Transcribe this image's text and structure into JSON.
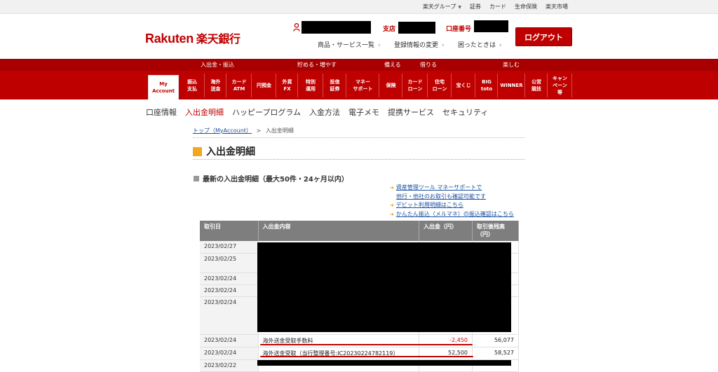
{
  "util_links": [
    "楽天グループ",
    "証券",
    "カード",
    "生命保険",
    "楽天市場"
  ],
  "header": {
    "logo_en": "Rakuten",
    "logo_jp": "楽天銀行",
    "branch_label": "支店",
    "account_label": "口座番号",
    "links": [
      "商品・サービス一覧",
      "登録情報の変更",
      "困ったときは"
    ],
    "logout": "ログアウト"
  },
  "categories": [
    "入出金・振込",
    "貯める・増やす",
    "備える",
    "借りる",
    "楽しむ"
  ],
  "nav": [
    "My\nAccount",
    "振込\n支払",
    "海外\n送金",
    "カード\nATM",
    "円預金",
    "外貨\nFX",
    "特別\n運用",
    "投信\n証券",
    "マネー\nサポート",
    "保険",
    "カード\nローン",
    "住宅\nローン",
    "宝くじ",
    "BIG\ntoto",
    "WINNER",
    "公営\n競技",
    "キャン\nペーン\n等"
  ],
  "subnav": [
    "口座情報",
    "入出金明細",
    "ハッピープログラム",
    "入金方法",
    "電子メモ",
    "提携サービス",
    "セキュリティ"
  ],
  "breadcrumb": {
    "home": "トップ（MyAccount）",
    "sep": ">",
    "current": "入出金明細"
  },
  "page_title": "入出金明細",
  "section_title": "最新の入出金明細（最大50件・24ヶ月以内）",
  "side_links": {
    "l1a": "資産管理ツール マネーサポートで",
    "l1b": "他行・他社のお取引も確認可能です",
    "l2": "デビット利用明細はこちら",
    "l3": "かんたん振込（メルマネ）の振込確認はこちら"
  },
  "table": {
    "headers": [
      "取引日",
      "入出金内容",
      "入出金（円）",
      "取引後残高（円）"
    ],
    "rows": [
      {
        "date": "2023/02/27",
        "desc": "",
        "amount": "",
        "balance": ""
      },
      {
        "date": "2023/02/25",
        "desc": "",
        "amount": "",
        "balance": ""
      },
      {
        "date": "2023/02/24",
        "desc": "",
        "amount": "",
        "balance": ""
      },
      {
        "date": "2023/02/24",
        "desc": "",
        "amount": "",
        "balance": ""
      },
      {
        "date": "2023/02/24",
        "desc": "",
        "amount": "",
        "balance": ""
      },
      {
        "date": "2023/02/24",
        "desc": "海外送金受取手数料",
        "amount": "-2,450",
        "balance": "56,077"
      },
      {
        "date": "2023/02/24",
        "desc": "海外送金受取（当行整理番号:IC20230224782119）",
        "amount": "52,500",
        "balance": "58,527"
      },
      {
        "date": "2023/02/22",
        "desc": "",
        "amount": "",
        "balance": ""
      }
    ]
  },
  "colors": {
    "brand_red": "#bf0000",
    "title_square": "#f1a81f"
  }
}
